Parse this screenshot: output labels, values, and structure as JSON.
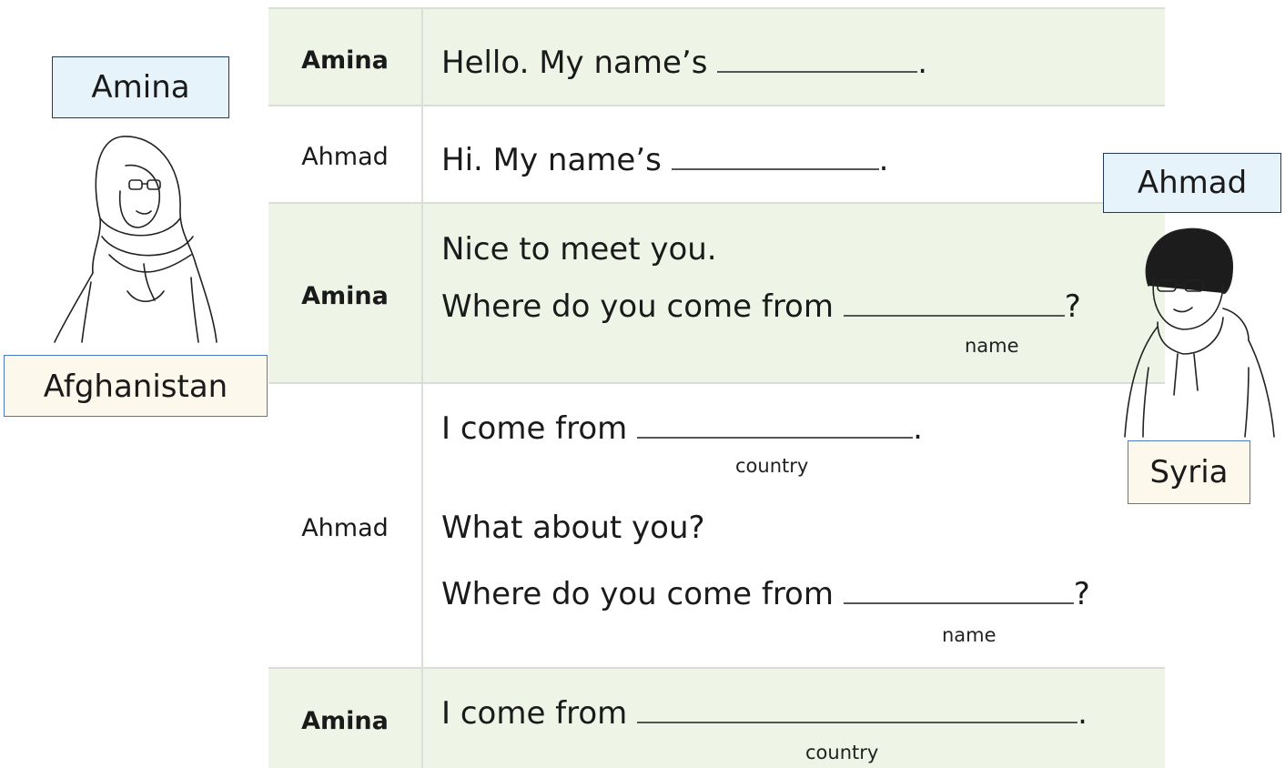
{
  "characters": {
    "left": {
      "name": "Amina",
      "country": "Afghanistan"
    },
    "right": {
      "name": "Ahmad",
      "country": "Syria"
    }
  },
  "dialogue": {
    "row1": {
      "speaker": "Amina",
      "line1_before": "Hello. My name’s ",
      "line1_after": "."
    },
    "row2": {
      "speaker": "Ahmad",
      "line1_before": "Hi. My name’s ",
      "line1_after": "."
    },
    "row3": {
      "speaker": "Amina",
      "line1": "Nice to meet you.",
      "line2_before": "Where do you come from ",
      "line2_after": "?",
      "hint": "name"
    },
    "row4": {
      "speaker": "Ahmad",
      "line1_before": "I come from ",
      "line1_after": ".",
      "hint1": "country",
      "line2": "What about you?",
      "line3_before": "Where do you come from ",
      "line3_after": "?",
      "hint2": "name"
    },
    "row5": {
      "speaker": "Amina",
      "line1_before": "I come from ",
      "line1_after": ".",
      "hint": "country"
    }
  }
}
